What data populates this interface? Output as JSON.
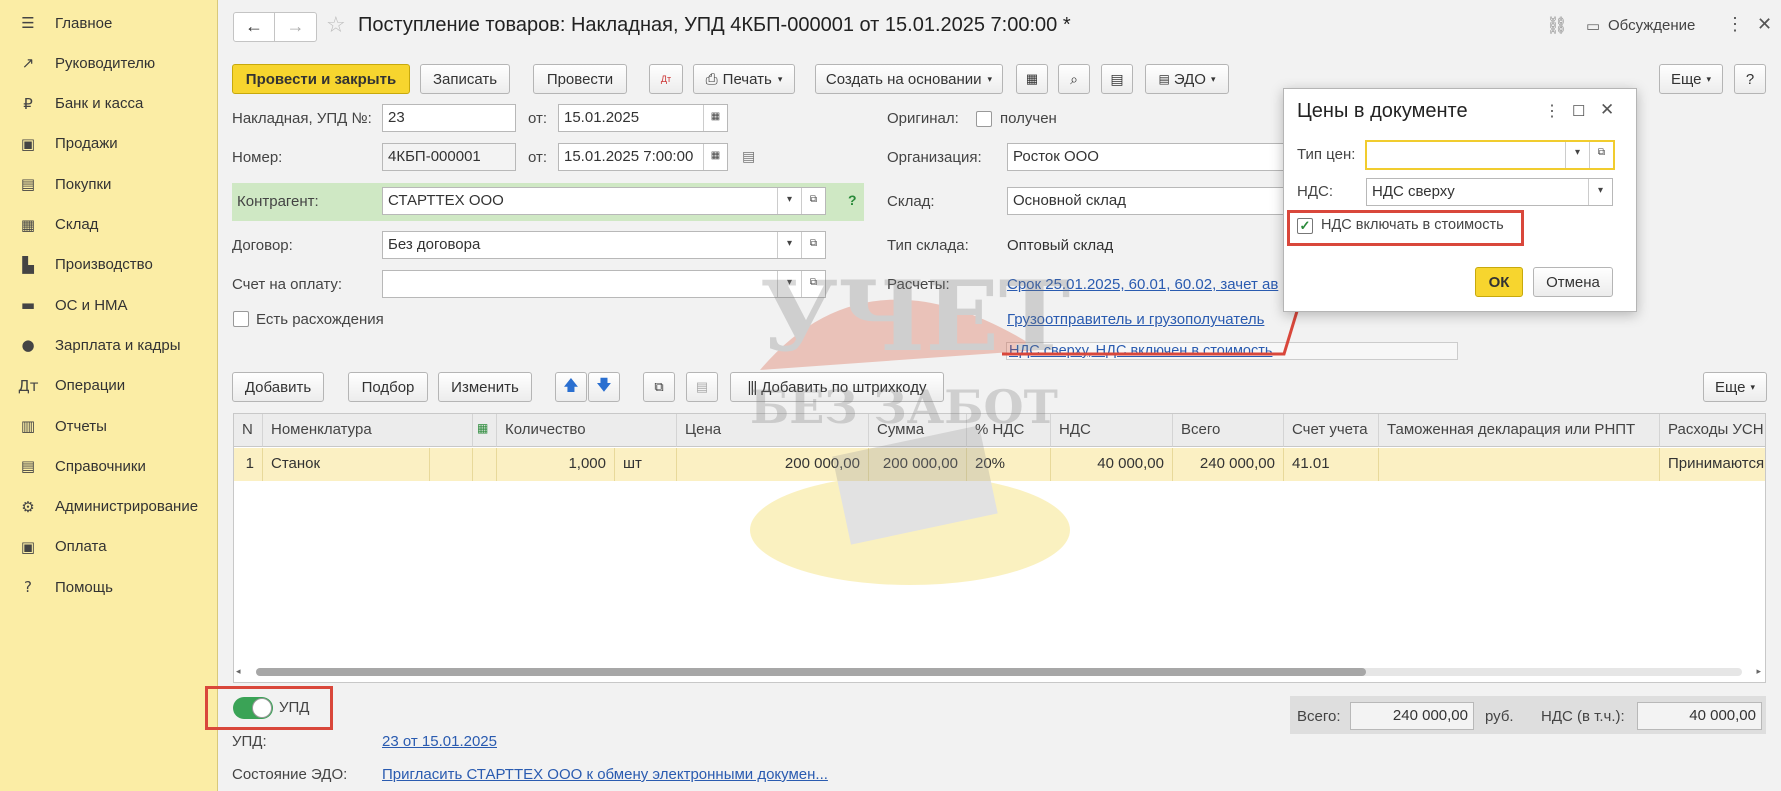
{
  "sidebar": {
    "items": [
      {
        "icon": "menu-icon",
        "glyph": "☰",
        "label": "Главное"
      },
      {
        "icon": "chart-line-icon",
        "glyph": "↗",
        "label": "Руководителю"
      },
      {
        "icon": "bank-icon",
        "glyph": "₽",
        "label": "Банк и касса"
      },
      {
        "icon": "shopping-bag-icon",
        "glyph": "▣",
        "label": "Продажи"
      },
      {
        "icon": "cart-icon",
        "glyph": "▤",
        "label": "Покупки"
      },
      {
        "icon": "warehouse-icon",
        "glyph": "▦",
        "label": "Склад"
      },
      {
        "icon": "factory-icon",
        "glyph": "▙",
        "label": "Производство"
      },
      {
        "icon": "truck-icon",
        "glyph": "▬",
        "label": "ОС и НМА"
      },
      {
        "icon": "person-icon",
        "glyph": "●",
        "label": "Зарплата и кадры"
      },
      {
        "icon": "debit-credit-icon",
        "glyph": "Дт",
        "label": "Операции"
      },
      {
        "icon": "bar-chart-icon",
        "glyph": "▥",
        "label": "Отчеты"
      },
      {
        "icon": "book-icon",
        "glyph": "▤",
        "label": "Справочники"
      },
      {
        "icon": "gear-icon",
        "glyph": "⚙",
        "label": "Администрирование"
      },
      {
        "icon": "wallet-icon",
        "glyph": "▣",
        "label": "Оплата"
      },
      {
        "icon": "help-icon",
        "glyph": "?",
        "label": "Помощь"
      }
    ]
  },
  "header": {
    "title": "Поступление товаров: Накладная, УПД 4КБП-000001 от 15.01.2025 7:00:00 *",
    "discussion_label": "Обсуждение"
  },
  "toolbar": {
    "post_close": "Провести и закрыть",
    "save": "Записать",
    "post": "Провести",
    "print": "Печать",
    "create_based": "Создать на основании",
    "edo": "ЭДО",
    "more": "Еще",
    "help": "?"
  },
  "form": {
    "invoice_label": "Накладная, УПД №:",
    "invoice_value": "23",
    "from_label": "от:",
    "invoice_date": "15.01.2025",
    "number_label": "Номер:",
    "number_value": "4КБП-000001",
    "number_date": "15.01.2025  7:00:00",
    "contractor_label": "Контрагент:",
    "contractor_value": "СТАРТТЕХ ООО",
    "contract_label": "Договор:",
    "contract_value": "Без договора",
    "payment_invoice_label": "Счет на оплату:",
    "payment_invoice_value": "",
    "discrepancy_label": "Есть расхождения",
    "original_label": "Оригинал:",
    "original_value": "получен",
    "organization_label": "Организация:",
    "organization_value": "Росток ООО",
    "warehouse_label": "Склад:",
    "warehouse_value": "Основной склад",
    "warehouse_type_label": "Тип склада:",
    "warehouse_type_value": "Оптовый склад",
    "settlements_label": "Расчеты:",
    "settlements_link": "Срок 25.01.2025, 60.01, 60.02, зачет ав",
    "shipper_link": "Грузоотправитель и грузополучатель",
    "vat_link": "НДС сверху, НДС включен в стоимость"
  },
  "table_toolbar": {
    "add": "Добавить",
    "pick": "Подбор",
    "edit": "Изменить",
    "barcode": "Добавить по штрихкоду",
    "more": "Еще"
  },
  "table": {
    "columns": [
      "N",
      "Номенклатура",
      "Количество",
      "Цена",
      "Сумма",
      "% НДС",
      "НДС",
      "Всего",
      "Счет учета",
      "Таможенная декларация или РНПТ",
      "Расходы УСН"
    ],
    "rows": [
      {
        "n": "1",
        "name": "Станок",
        "qty": "1,000",
        "unit": "шт",
        "price": "200 000,00",
        "sum": "200 000,00",
        "vat_rate": "20%",
        "vat": "40 000,00",
        "total": "240 000,00",
        "account": "41.01",
        "customs": "",
        "usn": "Принимаются"
      }
    ]
  },
  "footer": {
    "upd_toggle_label": "УПД",
    "upd_label": "УПД:",
    "upd_link": "23 от 15.01.2025",
    "edo_state_label": "Состояние ЭДО:",
    "edo_state_link": "Пригласить СТАРТТЕХ ООО к обмену электронными докумен...",
    "total_label": "Всего:",
    "total_value": "240 000,00",
    "currency": "руб.",
    "vat_included_label": "НДС (в т.ч.):",
    "vat_included_value": "40 000,00"
  },
  "popup": {
    "title": "Цены в документе",
    "price_type_label": "Тип цен:",
    "price_type_value": "",
    "vat_label": "НДС:",
    "vat_value": "НДС сверху",
    "include_vat_label": "НДС включать в стоимость",
    "include_vat_checked": true,
    "ok": "ОК",
    "cancel": "Отмена"
  },
  "watermark": {
    "line1": "УЧЕТ",
    "line2": "БЕЗ ЗАБОТ"
  },
  "colors": {
    "sidebar_bg": "#fbeda5",
    "primary_button": "#f7d52e",
    "link": "#2a5bb0",
    "highlight_row": "#fbf0c3",
    "annotation_red": "#d9473b",
    "toggle_green": "#3aa356"
  }
}
